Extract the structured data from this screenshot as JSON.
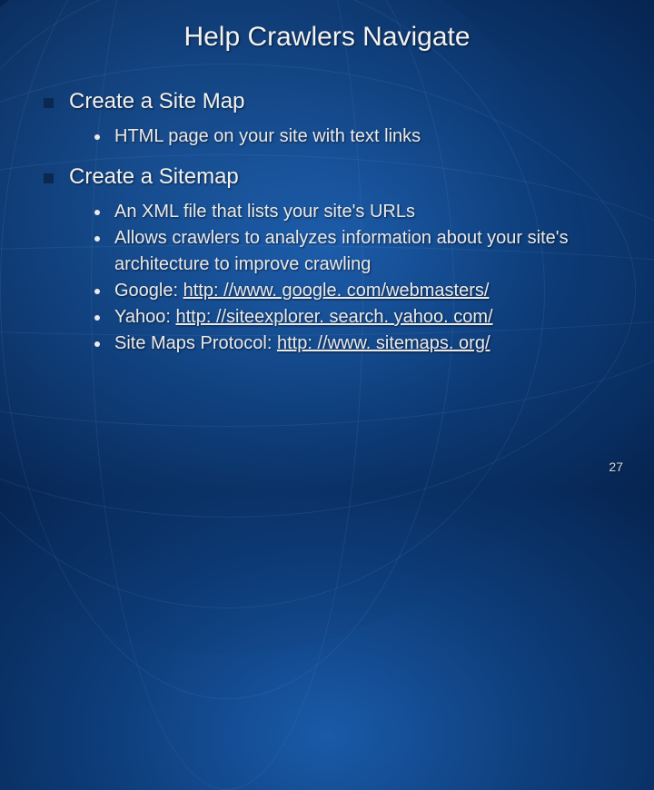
{
  "title": "Help Crawlers Navigate",
  "page_number": "27",
  "sections": [
    {
      "heading": "Create a Site Map",
      "items": [
        {
          "text": "HTML page on your site with text links"
        }
      ]
    },
    {
      "heading": "Create a Sitemap",
      "items": [
        {
          "text": "An XML file that lists your site's URLs"
        },
        {
          "text": "Allows crawlers to analyzes information about your site's architecture to improve crawling"
        },
        {
          "prefix": "Google: ",
          "link": "http: //www. google. com/webmasters/"
        },
        {
          "prefix": "Yahoo: ",
          "link": "http: //siteexplorer. search. yahoo. com/"
        },
        {
          "prefix": "Site Maps Protocol: ",
          "link": "http: //www. sitemaps. org/"
        }
      ]
    }
  ]
}
